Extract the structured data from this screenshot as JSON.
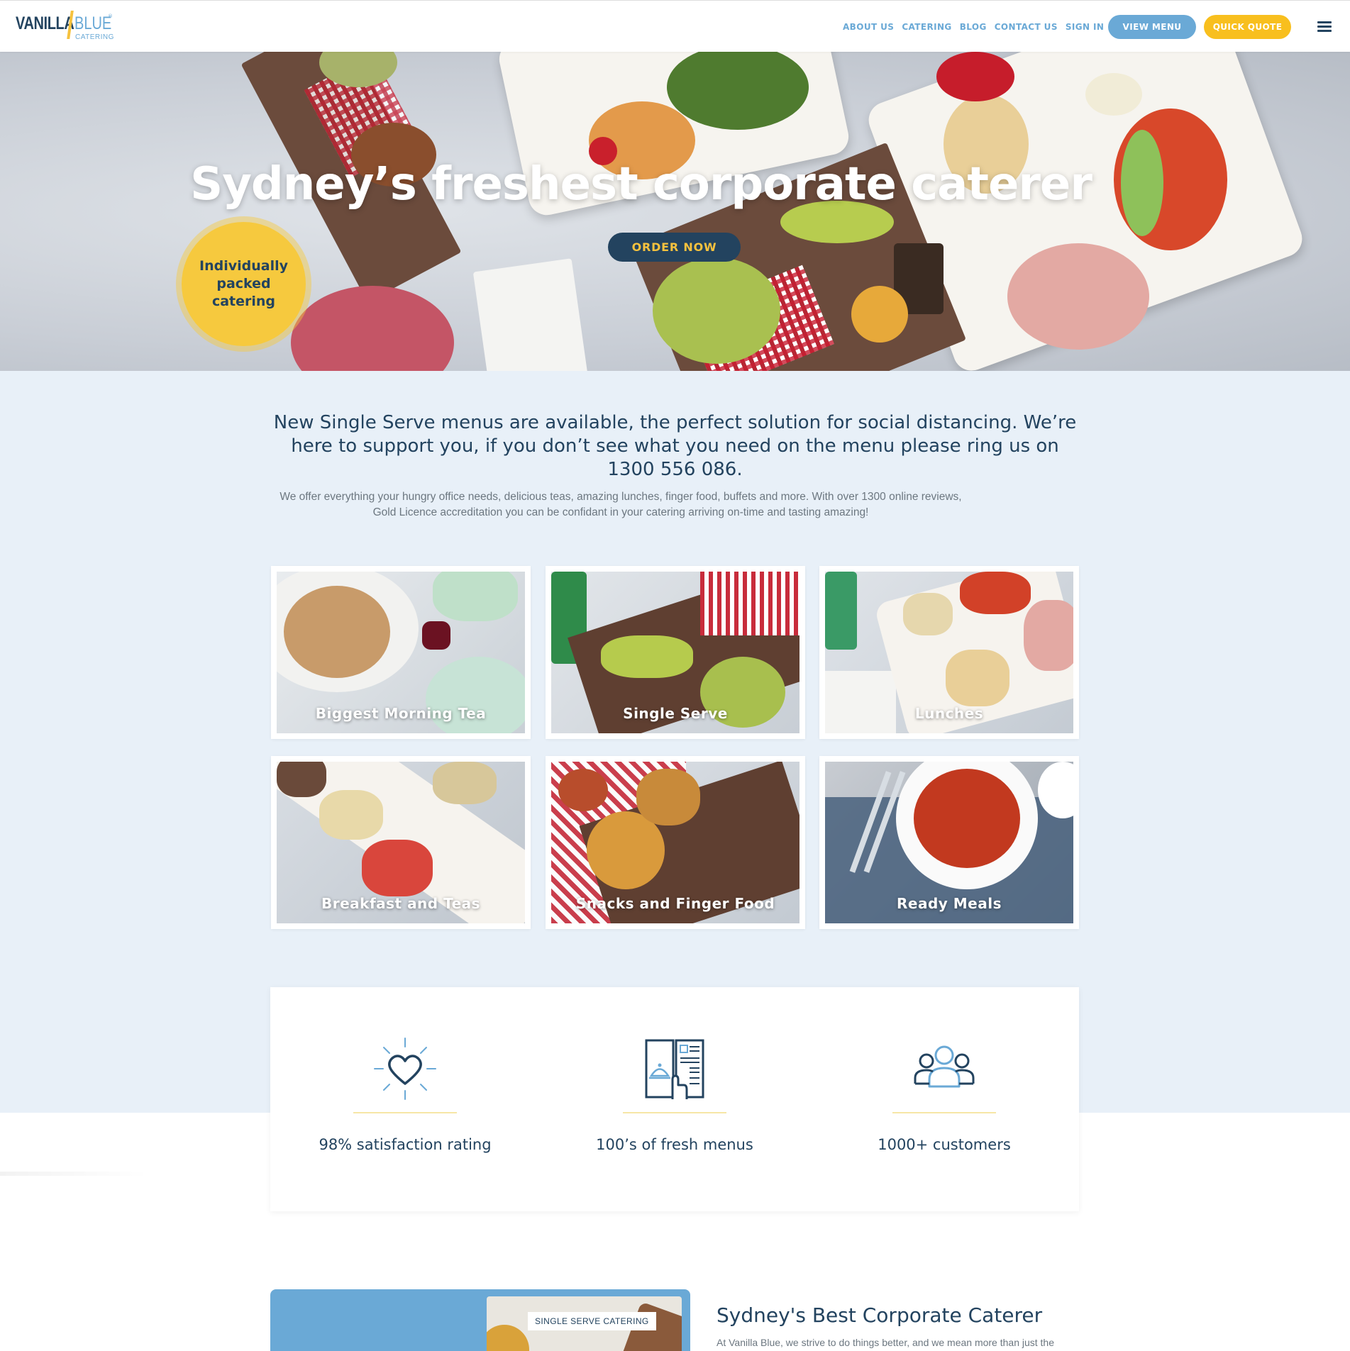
{
  "header": {
    "logo": {
      "word1": "VANILLA",
      "word2": "BLUE",
      "sub": "CATERING",
      "mark": "®"
    },
    "nav": [
      "ABOUT US",
      "CATERING",
      "BLOG",
      "CONTACT US",
      "SIGN IN"
    ],
    "view_menu": "VIEW MENU",
    "quick_quote": "QUICK QUOTE",
    "menu_icon": "hamburger-icon"
  },
  "hero": {
    "title": "Sydney’s freshest corporate caterer",
    "cta": "ORDER NOW",
    "badge": "Individually packed catering"
  },
  "intro": {
    "headline": "New Single Serve menus are available, the perfect solution for social distancing. We’re here to support you, if you don’t see what you need on the menu please ring us on 1300 556 086.",
    "body": "We offer everything your hungry office needs, delicious teas, amazing lunches, finger food, buffets and more.  With over 1300 online reviews, Gold Licence accreditation you can be confidant in your catering arriving on-time and tasting amazing!"
  },
  "categories": [
    {
      "label": "Biggest Morning Tea"
    },
    {
      "label": "Single Serve"
    },
    {
      "label": "Lunches"
    },
    {
      "label": "Breakfast and Teas"
    },
    {
      "label": "Snacks and Finger Food"
    },
    {
      "label": "Ready Meals"
    }
  ],
  "stats": [
    {
      "icon": "heart-icon",
      "label": "98% satisfaction rating"
    },
    {
      "icon": "menu-book-icon",
      "label": "100’s of fresh menus"
    },
    {
      "icon": "customers-icon",
      "label": "1000+ customers"
    }
  ],
  "promo": {
    "tag": "SINGLE SERVE CATERING",
    "title": "Sydney's Best Corporate Caterer",
    "body": "At Vanilla Blue, we strive to do things better, and we mean more than just the"
  },
  "colors": {
    "navy": "#23435f",
    "light_blue": "#6aa9d6",
    "yellow": "#f8bf1e",
    "section_bg": "#e8f0f8"
  }
}
